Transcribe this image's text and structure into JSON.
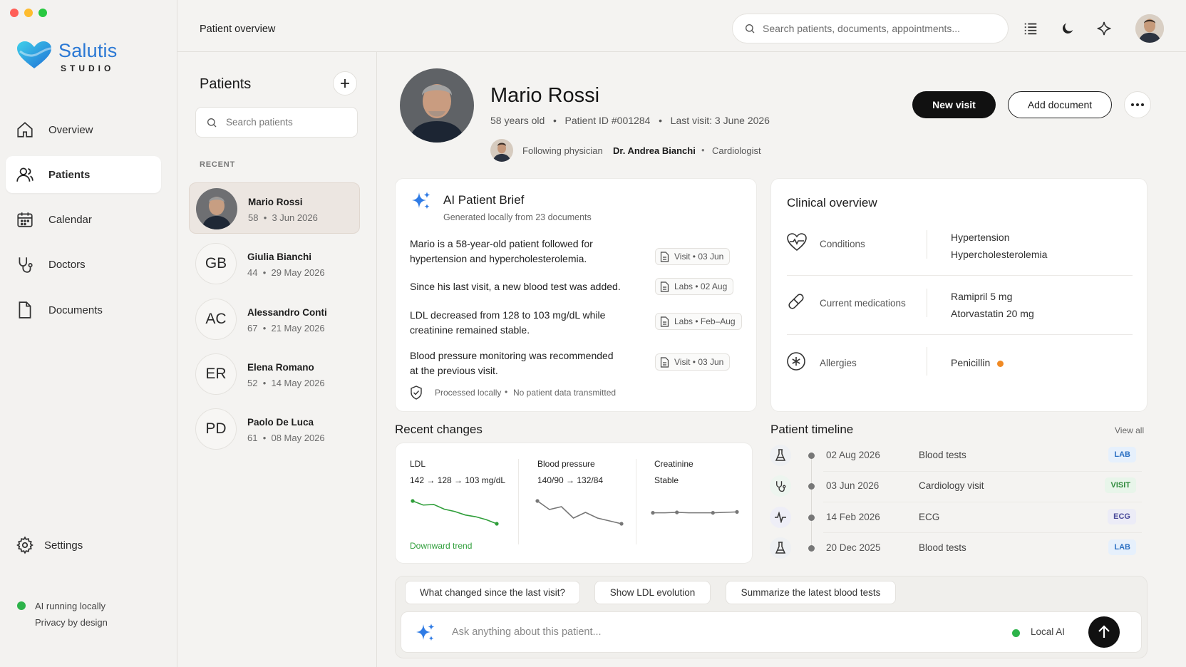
{
  "app": {
    "logo_name": "Salutis",
    "logo_sub": "STUDIO",
    "page_title": "Patient overview"
  },
  "sidebar": {
    "items": [
      {
        "label": "Overview",
        "icon": "home-icon"
      },
      {
        "label": "Patients",
        "icon": "users-icon"
      },
      {
        "label": "Calendar",
        "icon": "calendar-icon"
      },
      {
        "label": "Doctors",
        "icon": "stethoscope-icon"
      },
      {
        "label": "Documents",
        "icon": "document-icon"
      }
    ],
    "settings_label": "Settings",
    "ai_status": "AI running locally",
    "privacy": "Privacy by design"
  },
  "topbar": {
    "search_placeholder": "Search patients, documents, appointments..."
  },
  "patient_list": {
    "title": "Patients",
    "search_placeholder": "Search patients",
    "section_label": "RECENT",
    "patients": [
      {
        "initials": "",
        "name": "Mario Rossi",
        "age": "58",
        "date": "3 Jun 2026"
      },
      {
        "initials": "GB",
        "name": "Giulia Bianchi",
        "age": "44",
        "date": "29 May 2026"
      },
      {
        "initials": "AC",
        "name": "Alessandro Conti",
        "age": "67",
        "date": "21 May 2026"
      },
      {
        "initials": "ER",
        "name": "Elena Romano",
        "age": "52",
        "date": "14 May 2026"
      },
      {
        "initials": "PD",
        "name": "Paolo De Luca",
        "age": "61",
        "date": "08 May 2026"
      }
    ]
  },
  "patient": {
    "name": "Mario Rossi",
    "age": "58 years old",
    "id": "Patient ID #001284",
    "last_visit": "Last visit: 3 June 2026",
    "physician_label": "Following physician",
    "physician_name": "Dr. Andrea Bianchi",
    "physician_role": "Cardiologist"
  },
  "actions": {
    "new_visit": "New visit",
    "add_document": "Add document"
  },
  "ai_brief": {
    "title": "AI Patient Brief",
    "subtitle": "Generated locally from 23 documents",
    "items": [
      {
        "text": "Mario is a 58-year-old patient followed for hypertension and hypercholesterolemia.",
        "chip_type": "Visit",
        "chip_date": "03 Jun"
      },
      {
        "text": "Since his last visit, a new blood test was added.",
        "chip_type": "Labs",
        "chip_date": "02 Aug"
      },
      {
        "text": "LDL decreased from 128 to 103 mg/dL while creatinine remained stable.",
        "chip_type": "Labs",
        "chip_date": "Feb–Aug"
      },
      {
        "text": "Blood pressure monitoring was recommended at the previous visit.",
        "chip_type": "Visit",
        "chip_date": "03 Jun"
      }
    ],
    "footer_processed": "Processed locally",
    "footer_privacy": "No patient data transmitted"
  },
  "clinical": {
    "title": "Clinical overview",
    "conditions_label": "Conditions",
    "conditions": [
      "Hypertension",
      "Hypercholesterolemia"
    ],
    "medications_label": "Current medications",
    "medications": [
      "Ramipril 5 mg",
      "Atorvastatin 20 mg"
    ],
    "allergies_label": "Allergies",
    "allergies": [
      "Penicillin"
    ],
    "allergy_dot_color": "#f08a24"
  },
  "recent_changes": {
    "title": "Recent changes",
    "metrics": [
      {
        "label": "LDL",
        "value": "142 → 128 → 103 mg/dL",
        "note": "Downward trend",
        "trend": [
          142,
          135,
          136,
          128,
          124,
          118,
          115,
          110,
          103
        ],
        "color": "#2f9e3a"
      },
      {
        "label": "Blood pressure",
        "value": "140/90 → 132/84",
        "note": "",
        "trend": [
          140,
          137,
          138,
          134,
          136,
          134,
          133,
          132
        ],
        "color": "#777777"
      },
      {
        "label": "Creatinine",
        "value": "Stable",
        "note": "",
        "trend": [
          1.0,
          1.0,
          1.01,
          1.0,
          1.0,
          1.0,
          1.01,
          1.02
        ],
        "color": "#777777"
      }
    ]
  },
  "timeline": {
    "title": "Patient timeline",
    "view_all": "View all",
    "events": [
      {
        "date": "02 Aug 2026",
        "event": "Blood tests",
        "badge": "LAB",
        "icon": "flask-icon"
      },
      {
        "date": "03 Jun 2026",
        "event": "Cardiology visit",
        "badge": "VISIT",
        "icon": "stethoscope-icon"
      },
      {
        "date": "14 Feb 2026",
        "event": "ECG",
        "badge": "ECG",
        "icon": "pulse-icon"
      },
      {
        "date": "20 Dec 2025",
        "event": "Blood tests",
        "badge": "LAB",
        "icon": "flask-icon"
      }
    ]
  },
  "ask": {
    "suggestions": [
      "What changed since the last visit?",
      "Show LDL evolution",
      "Summarize the latest blood tests"
    ],
    "placeholder": "Ask anything about this patient...",
    "local_ai": "Local AI"
  },
  "colors": {
    "accent": "#111111",
    "status_green": "#2db34a",
    "logo_blue": "#2e8fe0",
    "logo_cyan": "#39c2e8"
  }
}
